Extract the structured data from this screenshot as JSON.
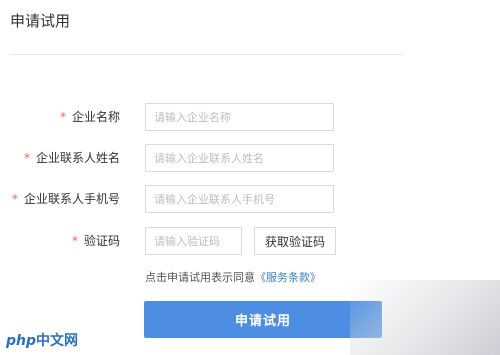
{
  "page": {
    "title": "申请试用"
  },
  "form": {
    "company_name": {
      "label": "企业名称",
      "placeholder": "请输入企业名称"
    },
    "contact_name": {
      "label": "企业联系人姓名",
      "placeholder": "请输入企业联系人姓名"
    },
    "contact_phone": {
      "label": "企业联系人手机号",
      "placeholder": "请输入企业联系人手机号"
    },
    "captcha": {
      "label": "验证码",
      "placeholder": "请输入验证码",
      "button_label": "获取验证码"
    },
    "required_mark": "*",
    "agree_text": "点击申请试用表示同意",
    "terms_link": "《服务条款》",
    "submit_label": "申请试用"
  },
  "watermark": {
    "text": "php",
    "suffix": "中文网"
  },
  "colors": {
    "accent": "#4d8ee3",
    "required": "#ff5a4f",
    "link": "#3b82c6"
  }
}
